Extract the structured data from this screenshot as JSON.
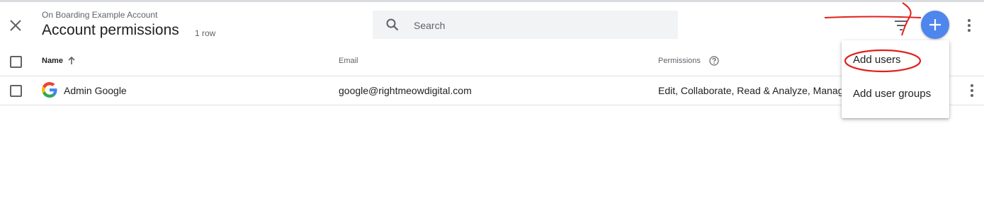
{
  "header": {
    "account_name": "On Boarding Example Account",
    "title": "Account permissions",
    "row_count": "1 row",
    "close_icon": "close-icon",
    "filter_icon": "filter-icon",
    "add_icon": "plus-icon",
    "more_icon": "more-vert-icon"
  },
  "search": {
    "placeholder": "Search",
    "icon": "search-icon"
  },
  "table": {
    "columns": [
      "Name",
      "Email",
      "Permissions"
    ],
    "sort_icon": "arrow-up-icon",
    "help_icon": "help-circle-icon",
    "rows": [
      {
        "icon": "google-icon",
        "name": "Admin Google",
        "email": "google@rightmeowdigital.com",
        "permissions": "Edit, Collaborate, Read & Analyze, Manage Users"
      }
    ]
  },
  "add_menu": {
    "items": [
      "Add users",
      "Add user groups"
    ]
  },
  "colors": {
    "accent": "#4f86ed",
    "annotation": "#e0201b"
  }
}
